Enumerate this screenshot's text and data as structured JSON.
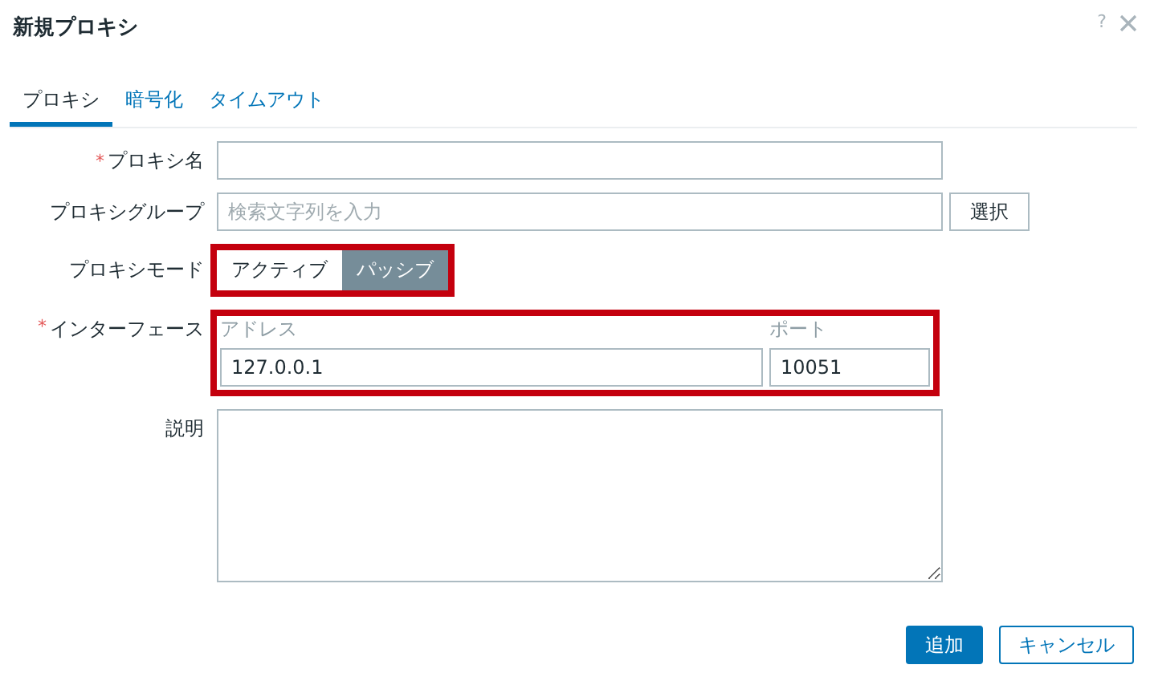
{
  "dialog": {
    "title": "新規プロキシ",
    "help": "?"
  },
  "tabs": [
    {
      "label": "プロキシ",
      "selected": true
    },
    {
      "label": "暗号化",
      "selected": false
    },
    {
      "label": "タイムアウト",
      "selected": false
    }
  ],
  "form": {
    "name": {
      "label": "プロキシ名",
      "required_mark": "*"
    },
    "group": {
      "label": "プロキシグループ",
      "placeholder": "検索文字列を入力",
      "button": "選択"
    },
    "mode": {
      "label": "プロキシモード",
      "highlighted": true,
      "options": [
        {
          "label": "アクティブ",
          "selected": false
        },
        {
          "label": "パッシブ",
          "selected": true
        }
      ]
    },
    "interface": {
      "label": "インターフェース",
      "required_mark": "*",
      "highlighted": true,
      "address_label": "アドレス",
      "address": "127.0.0.1",
      "port_label": "ポート",
      "port": "10051"
    },
    "description": {
      "label": "説明"
    }
  },
  "buttons": [
    {
      "label": "追加",
      "kind": "primary"
    },
    {
      "label": "キャンセル",
      "kind": "secondary"
    }
  ]
}
